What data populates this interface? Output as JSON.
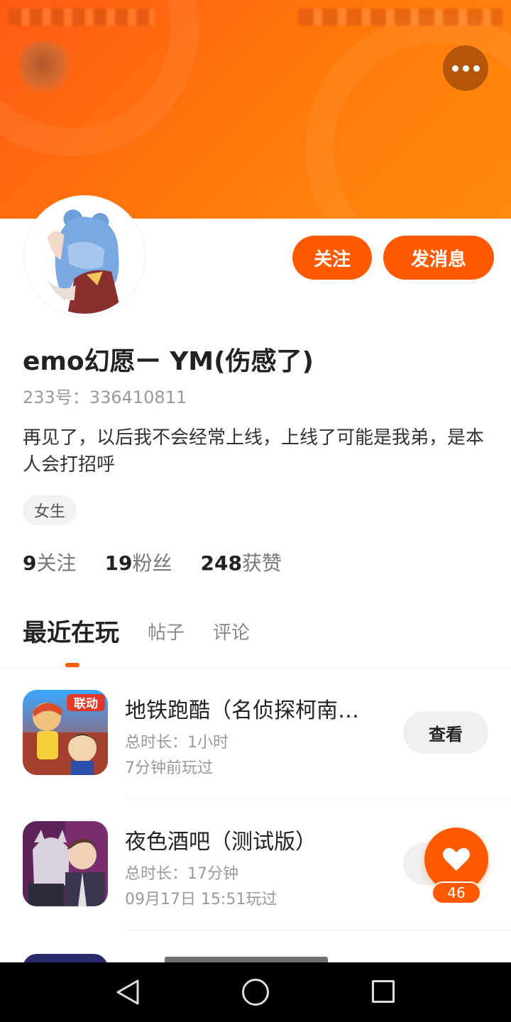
{
  "profile": {
    "username": "emo幻愿ー YM(伤感了)",
    "id_text": "233号：336410811",
    "bio": "再见了，以后我不会经常上线，上线了可能是我弟，是本人会打招呼",
    "gender_tag": "女生"
  },
  "actions": {
    "follow_label": "关注",
    "message_label": "发消息"
  },
  "stats": [
    {
      "num": "9",
      "label": "关注"
    },
    {
      "num": "19",
      "label": "粉丝"
    },
    {
      "num": "248",
      "label": "获赞"
    }
  ],
  "tabs": [
    {
      "label": "最近在玩",
      "active": true
    },
    {
      "label": "帖子",
      "active": false
    },
    {
      "label": "评论",
      "active": false
    }
  ],
  "games": [
    {
      "title": "地铁跑酷（名侦探柯南…",
      "duration": "总时长：1小时",
      "last_played": "7分钟前玩过",
      "button_label": "查看"
    },
    {
      "title": "夜色酒吧（测试版）",
      "duration": "总时长：17分钟",
      "last_played": "09月17日 15:51玩过",
      "button_label": "查看"
    }
  ],
  "icon_badge": "联动",
  "like": {
    "count": "46"
  },
  "colors": {
    "accent": "#ff5a00",
    "header_start": "#ff5a14",
    "header_end": "#ff8a10"
  },
  "icons": {
    "more": "more-dots-icon",
    "like": "heart-icon",
    "nav_back": "triangle-back-icon",
    "nav_home": "circle-home-icon",
    "nav_recent": "square-recent-icon"
  }
}
